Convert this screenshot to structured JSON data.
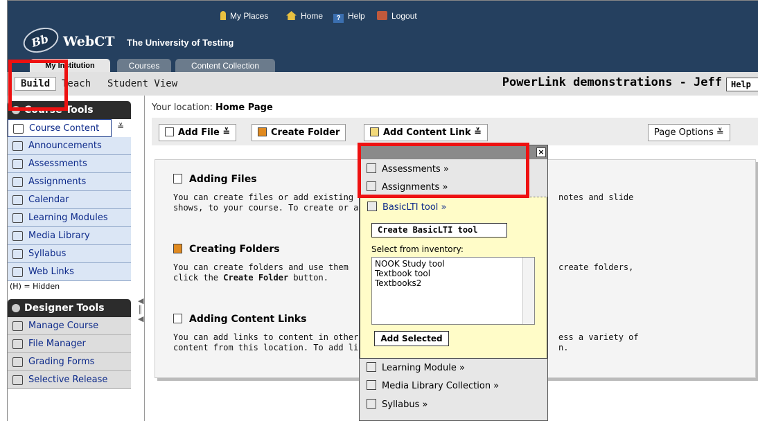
{
  "header": {
    "links": [
      "My Places",
      "Home",
      "Help",
      "Logout"
    ],
    "logo_text": "Bb",
    "brand": "WebCT",
    "institution": "The University of Testing",
    "tabs": [
      "My Institution",
      "Courses",
      "Content Collection"
    ]
  },
  "modes": {
    "build": "Build",
    "teach": "Teach",
    "student_view": "Student View"
  },
  "course_title": "PowerLink demonstrations - Jeff",
  "help_label": "Help",
  "sidebar": {
    "course_tools_title": "Course Tools",
    "course_tools": [
      {
        "label": "Course Content",
        "icon": "home-icon"
      },
      {
        "label": "Announcements",
        "icon": "megaphone-icon"
      },
      {
        "label": "Assessments",
        "icon": "assessment-icon"
      },
      {
        "label": "Assignments",
        "icon": "assignment-icon"
      },
      {
        "label": "Calendar",
        "icon": "calendar-icon"
      },
      {
        "label": "Learning Modules",
        "icon": "module-icon"
      },
      {
        "label": "Media Library",
        "icon": "media-icon"
      },
      {
        "label": "Syllabus",
        "icon": "syllabus-icon"
      },
      {
        "label": "Web Links",
        "icon": "weblink-icon"
      }
    ],
    "hidden_note": "(H) = Hidden",
    "designer_tools_title": "Designer Tools",
    "designer_tools": [
      {
        "label": "Manage Course",
        "icon": "manage-icon"
      },
      {
        "label": "File Manager",
        "icon": "file-manager-icon"
      },
      {
        "label": "Grading Forms",
        "icon": "grading-icon"
      },
      {
        "label": "Selective Release",
        "icon": "release-icon"
      }
    ]
  },
  "location": {
    "prefix": "Your location:",
    "page": "Home Page"
  },
  "toolbar": {
    "add_file": "Add File",
    "create_folder": "Create Folder",
    "add_content_link": "Add Content Link",
    "page_options": "Page Options"
  },
  "sections": [
    {
      "title": "Adding Files",
      "body1": "You can create files or add existing fil",
      "body2": "shows, to your course. To create or a",
      "tail1": "notes and slide"
    },
    {
      "title": "Creating Folders",
      "body1": "You can create folders and use them",
      "body2": "click the ",
      "bold": "Create Folder",
      "body3": " button.",
      "tail1": "create folders,"
    },
    {
      "title": "Adding Content Links",
      "body1": "You can add links to content in other",
      "body2": "content from this location. To add link",
      "tail1": "ess a variety of",
      "tail2": "n."
    }
  ],
  "menu": {
    "items_top": [
      "Assessments »",
      "Assignments »"
    ],
    "basiclti": "BasicLTI tool »",
    "create_basiclti": "Create BasicLTI tool",
    "inventory_label": "Select from inventory:",
    "inventory": [
      "NOOK Study tool",
      "Textbook tool",
      "Textbooks2"
    ],
    "add_selected": "Add Selected",
    "items_bottom": [
      "Learning Module »",
      "Media Library Collection »",
      "Syllabus »"
    ],
    "close": "×"
  },
  "colors": {
    "header_bg": "#25405f",
    "highlight": "#ee1111",
    "submenu_bg": "#fffcc8",
    "nav_link": "#0d2a8a"
  }
}
